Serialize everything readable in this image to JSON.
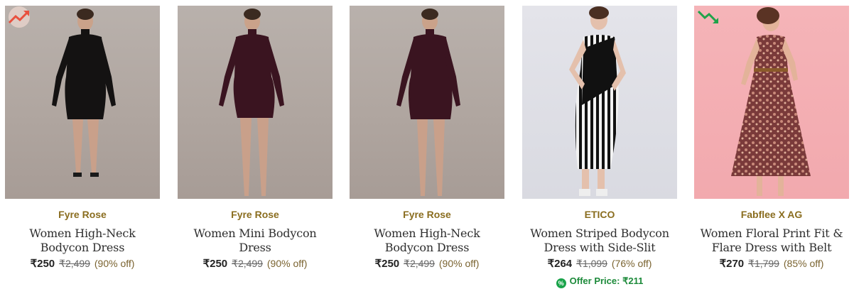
{
  "products": [
    {
      "brand": "Fyre Rose",
      "title": "Women High-Neck Bodycon Dress",
      "price": "₹250",
      "mrp": "₹2,499",
      "off": "(90% off)",
      "trend": "trending-up-icon",
      "dress_color": "#141212"
    },
    {
      "brand": "Fyre Rose",
      "title": "Women Mini Bodycon Dress",
      "price": "₹250",
      "mrp": "₹2,499",
      "off": "(90% off)",
      "trend": "",
      "dress_color": "#3a1420"
    },
    {
      "brand": "Fyre Rose",
      "title": "Women High-Neck Bodycon Dress",
      "price": "₹250",
      "mrp": "₹2,499",
      "off": "(90% off)",
      "trend": "",
      "dress_color": "#3a1420"
    },
    {
      "brand": "ETICO",
      "title": "Women Striped Bodycon Dress with Side-Slit",
      "price": "₹264",
      "mrp": "₹1,099",
      "off": "(76% off)",
      "trend": "",
      "offer": "Offer Price: ₹211",
      "dress_color": "#111111"
    },
    {
      "brand": "Fabflee X AG",
      "title": "Women Floral Print Fit & Flare Dress with Belt",
      "price": "₹270",
      "mrp": "₹1,799",
      "off": "(85% off)",
      "trend": "trending-down-icon",
      "dress_color": "#7a3a3a"
    }
  ],
  "colors": {
    "trend_up": "#e9503e",
    "trend_down": "#1fa34a",
    "brand": "#8a6d1f"
  }
}
